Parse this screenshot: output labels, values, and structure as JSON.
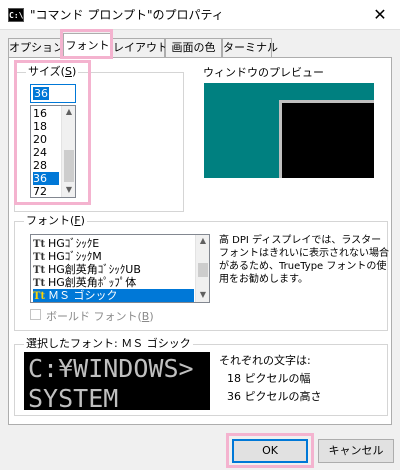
{
  "window": {
    "title": "\"コマンド プロンプト\"のプロパティ",
    "icon_text": "C:\\",
    "close_glyph": "✕"
  },
  "tabs": [
    {
      "label": "オプション"
    },
    {
      "label": "フォント"
    },
    {
      "label": "レイアウト"
    },
    {
      "label": "画面の色"
    },
    {
      "label": "ターミナル"
    }
  ],
  "active_tab": "フォント",
  "size": {
    "legend_prefix": "サイズ(",
    "legend_key": "S",
    "legend_suffix": ")",
    "value": "36",
    "items": [
      "16",
      "18",
      "20",
      "24",
      "28",
      "36",
      "72"
    ],
    "selected": "36"
  },
  "preview": {
    "label": "ウィンドウのプレビュー",
    "colors": {
      "desktop": "#008080",
      "console": "#000000"
    }
  },
  "font": {
    "legend_prefix": "フォント(",
    "legend_key": "F",
    "legend_suffix": ")",
    "items": [
      {
        "icon": "Tt",
        "label": "HGｺﾞｼｯｸE"
      },
      {
        "icon": "Tt",
        "label": "HGｺﾞｼｯｸM"
      },
      {
        "icon": "Tt",
        "label": "HG創英角ｺﾞｼｯｸUB"
      },
      {
        "icon": "Tt",
        "label": "HG創英角ﾎﾟｯﾌﾟ体"
      },
      {
        "icon": "Tt",
        "label": "ＭＳ ゴシック"
      }
    ],
    "selected": "ＭＳ ゴシック",
    "bold_label_prefix": "ボールド フォント(",
    "bold_label_key": "B",
    "bold_label_suffix": ")",
    "bold_checked": false,
    "description": [
      "高 DPI ディスプレイでは、ラスター",
      "フォントはきれいに表示されない場合",
      "があるため、TrueType フォントの使",
      "用をお勧めします。"
    ]
  },
  "selected_font": {
    "legend": "選択したフォント: ＭＳ ゴシック",
    "sample_lines": [
      "C:¥WINDOWS>",
      "SYSTEM"
    ],
    "info_title": "それぞれの文字は:",
    "width_line": "18 ピクセルの幅",
    "height_line": "36 ピクセルの高さ"
  },
  "buttons": {
    "ok": "OK",
    "cancel": "キャンセル"
  },
  "colors": {
    "highlight": "#f4b3cf",
    "selection": "#0078d7"
  }
}
